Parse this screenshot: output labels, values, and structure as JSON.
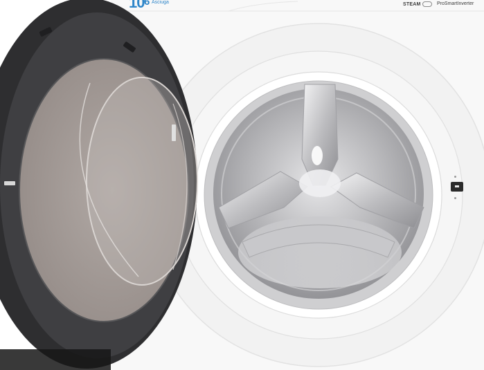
{
  "image": {
    "subject": "Front-loading washer-dryer with open door showing stainless steel drum",
    "colors": {
      "cabinet": "#f7f7f7",
      "door_ring": "#3b3b3d",
      "door_glass": "#a8a09c",
      "drum": "#b9b9bb",
      "drum_highlight": "#f2f2f2",
      "brand_blue": "#2f86c9"
    }
  },
  "cabinet": {
    "capacity_wash": "10",
    "capacity_dry": "6",
    "capacity_dry_label": "Asciuga",
    "steam_badge": "STEAM",
    "inverter_badge": "ProSmartInverter"
  },
  "icons": {
    "steam": "steam-cloud-icon",
    "door_lock": "door-lock-indicator-icon"
  }
}
